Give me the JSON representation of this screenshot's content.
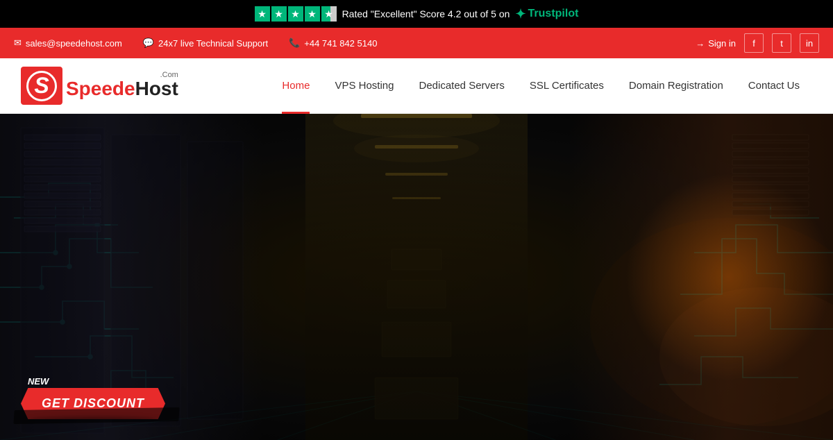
{
  "trustpilot": {
    "rating_text": "Rated \"Excellent\" Score 4.2 out of 5 on",
    "platform": "Trustpilot",
    "stars_count": 4,
    "half_star": true
  },
  "contact_bar": {
    "email": "sales@speedehost.com",
    "support": "24x7 live Technical Support",
    "phone": "+44 741 842 5140",
    "sign_in": "Sign in"
  },
  "nav": {
    "home": "Home",
    "vps_hosting": "VPS Hosting",
    "dedicated_servers": "Dedicated Servers",
    "ssl_certificates": "SSL Certificates",
    "domain_registration": "Domain Registration",
    "contact_us": "Contact Us"
  },
  "logo": {
    "brand": "SpeedeHost",
    "tld": ".Com"
  },
  "hero": {
    "new_label": "NEW",
    "discount_label": "GET DISCOUNT"
  }
}
